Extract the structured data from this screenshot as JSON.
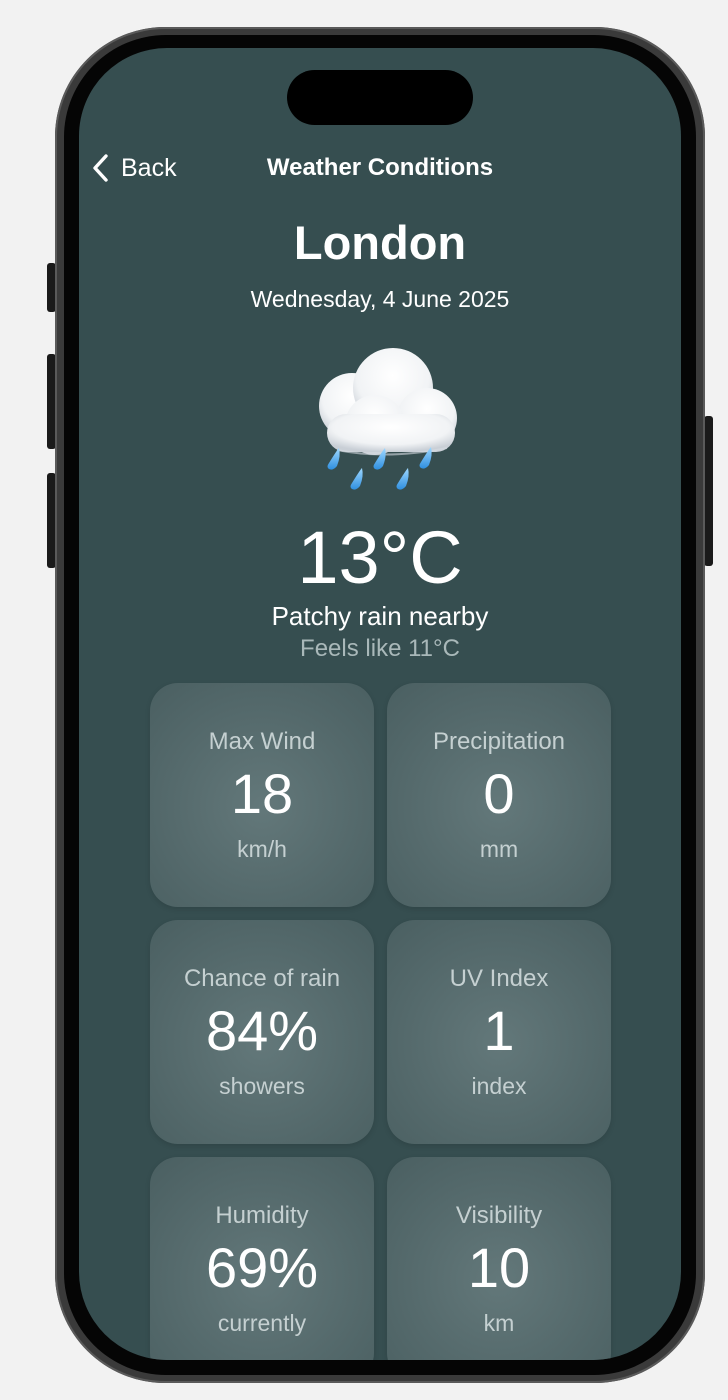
{
  "nav": {
    "back_label": "Back",
    "title": "Weather Conditions"
  },
  "location": {
    "city": "London",
    "date": "Wednesday, 4 June 2025"
  },
  "current": {
    "icon": "cloud-with-rain-icon",
    "temperature": "13°C",
    "condition": "Patchy rain nearby",
    "feels_like": "Feels like 11°C"
  },
  "stats": [
    {
      "label": "Max Wind",
      "value": "18",
      "unit": "km/h"
    },
    {
      "label": "Precipitation",
      "value": "0",
      "unit": "mm"
    },
    {
      "label": "Chance of rain",
      "value": "84%",
      "unit": "showers"
    },
    {
      "label": "UV Index",
      "value": "1",
      "unit": "index"
    },
    {
      "label": "Humidity",
      "value": "69%",
      "unit": "currently"
    },
    {
      "label": "Visibility",
      "value": "10",
      "unit": "km"
    }
  ],
  "colors": {
    "background": "#364e50",
    "tile": "#556a6c",
    "text_primary": "#ffffff",
    "text_secondary": "#c5d0d1"
  }
}
